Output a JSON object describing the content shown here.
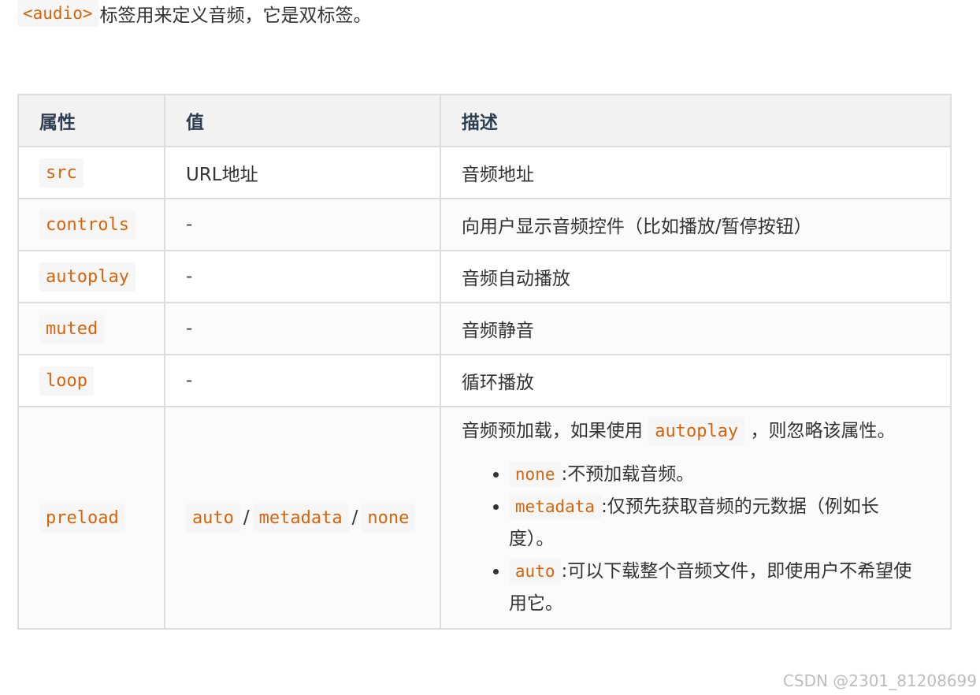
{
  "intro": {
    "tag": "<audio>",
    "text": "标签用来定义音频，它是双标签。"
  },
  "table": {
    "headers": [
      "属性",
      "值",
      "描述"
    ],
    "rows": [
      {
        "attr": "src",
        "value": "URL地址",
        "desc": "音频地址"
      },
      {
        "attr": "controls",
        "value": "-",
        "desc": "向用户显示音频控件（比如播放/暂停按钮）"
      },
      {
        "attr": "autoplay",
        "value": "-",
        "desc": "音频自动播放"
      },
      {
        "attr": "muted",
        "value": "-",
        "desc": "音频静音"
      },
      {
        "attr": "loop",
        "value": "-",
        "desc": "循环播放"
      }
    ],
    "preload": {
      "attr": "preload",
      "values": [
        "auto",
        "/",
        "metadata",
        "/",
        "none"
      ],
      "desc_before": "音频预加载，如果使用",
      "desc_code": "autoplay",
      "desc_after": "，则忽略该属性。",
      "options": [
        {
          "code": "none",
          "text": ":不预加载音频。"
        },
        {
          "code": "metadata",
          "text": ":仅预先获取音频的元数据（例如长度）。"
        },
        {
          "code": "auto",
          "text": ":可以下载整个音频文件，即使用户不希望使用它。"
        }
      ]
    }
  },
  "watermark": "CSDN @2301_81208699"
}
